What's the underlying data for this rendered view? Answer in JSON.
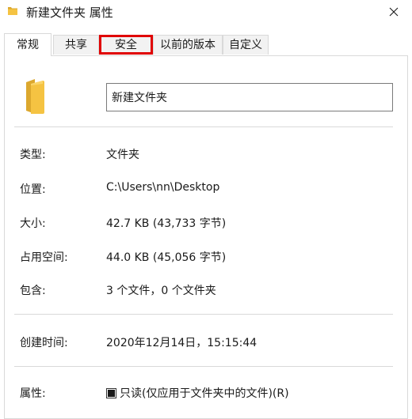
{
  "window": {
    "title": "新建文件夹 属性",
    "folder_icon": "folder-icon",
    "close_icon": "close-icon"
  },
  "tabs": [
    {
      "label": "常规",
      "active": true
    },
    {
      "label": "共享",
      "active": false
    },
    {
      "label": "安全",
      "active": false,
      "highlighted": true
    },
    {
      "label": "以前的版本",
      "active": false
    },
    {
      "label": "自定义",
      "active": false
    }
  ],
  "general": {
    "folder_name": "新建文件夹",
    "type_label": "类型:",
    "type_value": "文件夹",
    "location_label": "位置:",
    "location_value": "C:\\Users\\nn\\Desktop",
    "size_label": "大小:",
    "size_value": "42.7 KB (43,733 字节)",
    "disk_size_label": "占用空间:",
    "disk_size_value": "44.0 KB (45,056 字节)",
    "contains_label": "包含:",
    "contains_value": "3 个文件，0 个文件夹",
    "created_label": "创建时间:",
    "created_value": "2020年12月14日，15:15:44",
    "attributes_label": "属性:",
    "readonly_label": "只读(仅应用于文件夹中的文件)(R)",
    "readonly_state": "indeterminate"
  },
  "colors": {
    "highlight": "#e00000",
    "folder": "#f5c342",
    "folder_dark": "#dca82e"
  }
}
